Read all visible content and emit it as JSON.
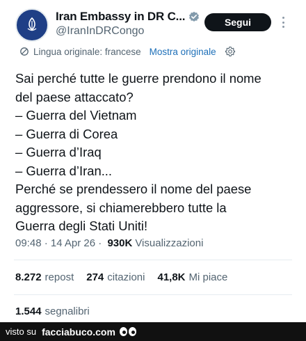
{
  "account": {
    "display_name": "Iran Embassy in DR C...",
    "handle": "@IranInDRCongo",
    "follow_label": "Segui",
    "verified_color": "#829aab"
  },
  "translation": {
    "original_language": "Lingua originale: francese",
    "show_original": "Mostra originale"
  },
  "tweet": {
    "lines": [
      "Sai perché tutte le guerre prendono il nome",
      "del paese attaccato?",
      "– Guerra del Vietnam",
      "– Guerra di Corea",
      "– Guerra d’Iraq",
      "– Guerra d’Iran...",
      "Perché se prendessero il nome del paese",
      "aggressore, si chiamerebbero tutte la",
      "Guerra degli Stati Uniti!"
    ]
  },
  "meta": {
    "time": "09:48",
    "separator1": " · ",
    "date": "14 Apr 26",
    "separator2": " · ",
    "views": "930K",
    "views_label": "Visualizzazioni"
  },
  "stats": {
    "reposts": "8.272",
    "reposts_label": "repost",
    "quotes": "274",
    "quotes_label": "citazioni",
    "likes": "41,8K",
    "likes_label": "Mi piace",
    "bookmarks": "1.544",
    "bookmarks_label": "segnalibri"
  },
  "footer": {
    "prefix": "visto su",
    "site": "facciabuco.com"
  }
}
